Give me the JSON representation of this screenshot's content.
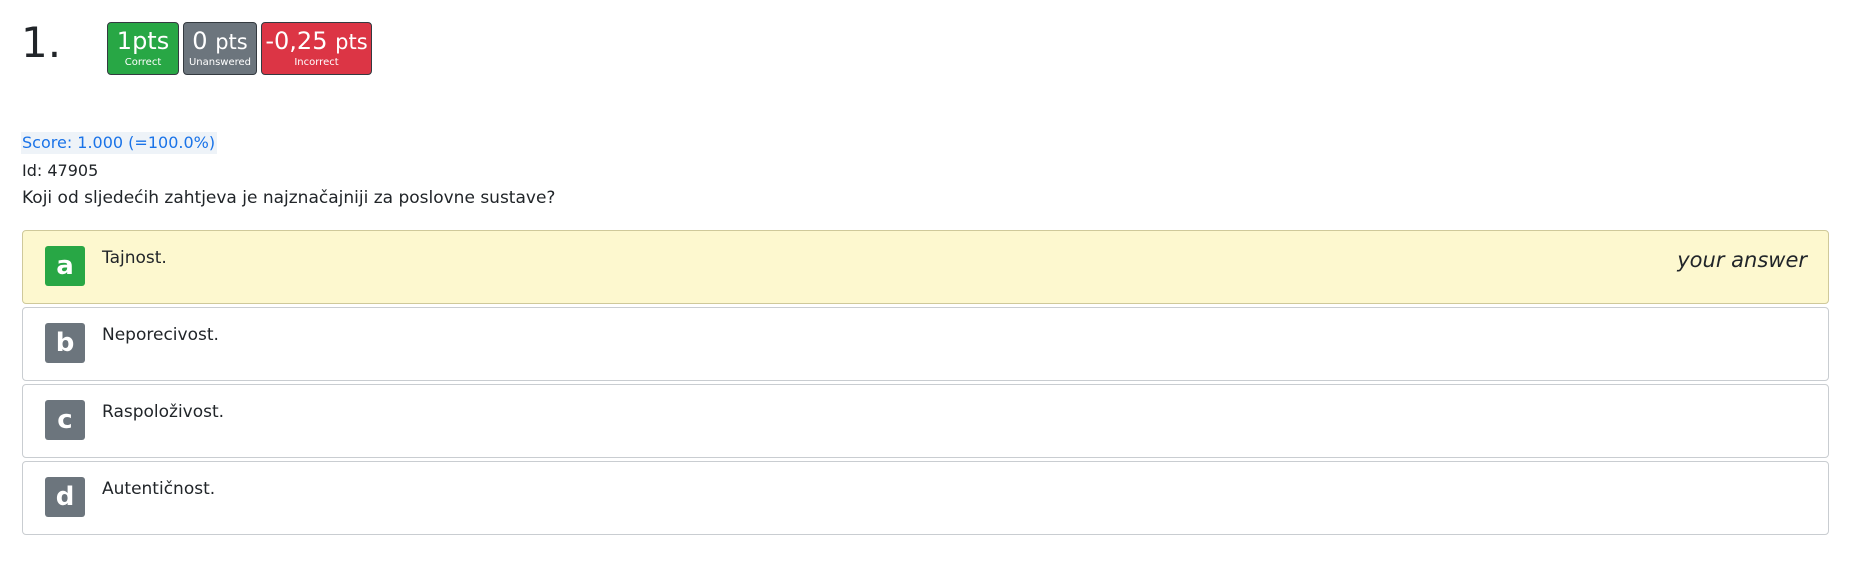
{
  "question": {
    "number": "1.",
    "score_text": "Score: 1.000 (=100.0%)",
    "id_text": "Id: 47905",
    "text": "Koji od sljedećih zahtjeva je najznačajniji za poslovne sustave?"
  },
  "badges": {
    "correct": {
      "value": "1",
      "unit": "pts",
      "label": "Correct",
      "color": "#28a745"
    },
    "unanswered": {
      "value": "0",
      "unit": "pts",
      "label": "Unanswered",
      "color": "#6c757d"
    },
    "incorrect": {
      "value": "-0,25",
      "unit": "pts",
      "label": "Incorrect",
      "color": "#dc3545"
    }
  },
  "answers": [
    {
      "letter": "a",
      "text": "Tajnost.",
      "note": "your answer",
      "selected": true,
      "correct": true
    },
    {
      "letter": "b",
      "text": "Neporecivost."
    },
    {
      "letter": "c",
      "text": "Raspoloživost."
    },
    {
      "letter": "d",
      "text": "Autentičnost."
    }
  ],
  "colors": {
    "selected_bg": "#fdf8cf",
    "score_text": "#1a73e8",
    "letter_default": "#6c757d",
    "letter_correct": "#28a745"
  }
}
